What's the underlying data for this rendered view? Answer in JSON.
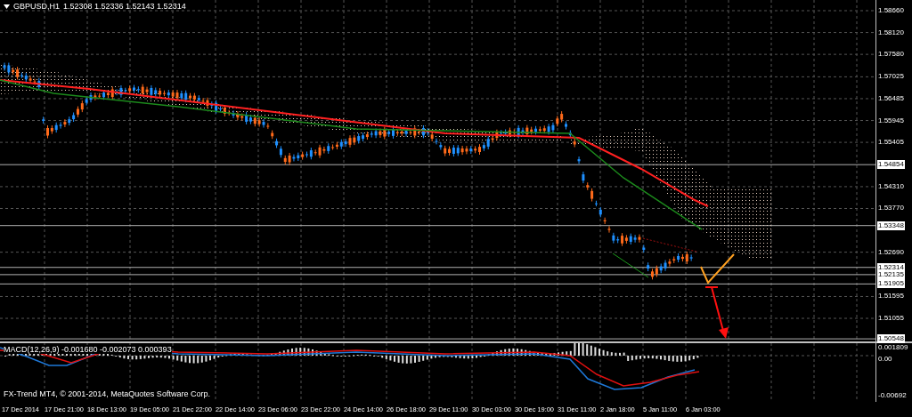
{
  "chart": {
    "symbol": "GBPUSD,H1",
    "quote": "1.52308 1.52336 1.52143 1.52314",
    "price_axis": [
      {
        "label": "1.58660",
        "kind": "grid"
      },
      {
        "label": "1.58120",
        "kind": "grid"
      },
      {
        "label": "1.57580",
        "kind": "grid"
      },
      {
        "label": "1.57025",
        "kind": "grid"
      },
      {
        "label": "1.56485",
        "kind": "grid"
      },
      {
        "label": "1.55945",
        "kind": "grid"
      },
      {
        "label": "1.55405",
        "kind": "grid"
      },
      {
        "label": "1.54854",
        "kind": "marker"
      },
      {
        "label": "1.54310",
        "kind": "grid"
      },
      {
        "label": "1.53770",
        "kind": "grid"
      },
      {
        "label": "1.53348",
        "kind": "marker"
      },
      {
        "label": "1.52690",
        "kind": "grid"
      },
      {
        "label": "1.52314",
        "kind": "marker"
      },
      {
        "label": "1.52135",
        "kind": "marker"
      },
      {
        "label": "1.51905",
        "kind": "marker"
      },
      {
        "label": "1.51595",
        "kind": "grid"
      },
      {
        "label": "1.51055",
        "kind": "grid"
      },
      {
        "label": "1.50548",
        "kind": "marker"
      }
    ],
    "indicator": {
      "label": "MACD(12,26,9) -0.001680 -0.002073 0.000393",
      "axis": [
        "0.001809",
        "0.00",
        "-0.00692"
      ]
    },
    "copyright": "FX-Trend MT4, © 2001-2014, MetaQuotes Software Corp.",
    "time_axis": [
      "17 Dec 2014",
      "17 Dec 21:00",
      "18 Dec 13:00",
      "19 Dec 05:00",
      "21 Dec 22:00",
      "22 Dec 14:00",
      "23 Dec 06:00",
      "23 Dec 22:00",
      "24 Dec 14:00",
      "26 Dec 18:00",
      "29 Dec 11:00",
      "30 Dec 03:00",
      "30 Dec 19:00",
      "31 Dec 11:00",
      "2 Jan 18:00",
      "5 Jan 11:00",
      "6 Jan 03:00"
    ]
  }
}
